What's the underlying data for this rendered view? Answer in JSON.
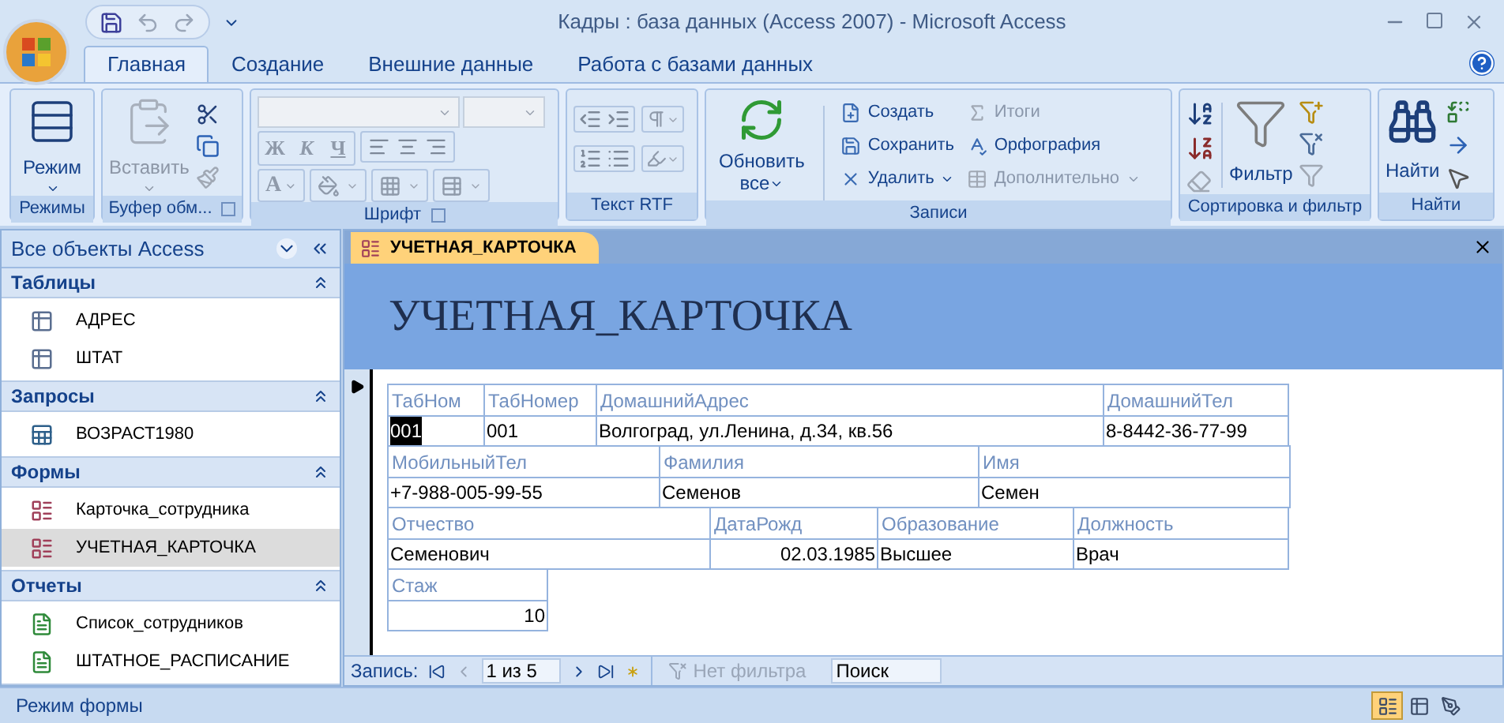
{
  "window": {
    "title": "Кадры : база данных (Access 2007) - Microsoft Access"
  },
  "ribbon_tabs": [
    {
      "label": "Главная",
      "selected": true
    },
    {
      "label": "Создание",
      "selected": false
    },
    {
      "label": "Внешние данные",
      "selected": false
    },
    {
      "label": "Работа с базами данных",
      "selected": false
    }
  ],
  "ribbon_groups": [
    {
      "kind": "views",
      "label": "Режимы",
      "launcher": false,
      "buttons": [
        {
          "label": "Режим",
          "disabled": false
        }
      ]
    },
    {
      "kind": "clipboard",
      "label": "Буфер обм...",
      "launcher": true,
      "buttons": [
        {
          "label": "Вставить",
          "disabled": true
        }
      ]
    },
    {
      "kind": "font",
      "label": "Шрифт",
      "launcher": true,
      "styles": [
        "Ж",
        "К",
        "Ч"
      ],
      "color_letter": "A",
      "disabled": true
    },
    {
      "kind": "rtf",
      "label": "Текст RTF",
      "launcher": false
    },
    {
      "kind": "records",
      "label": "Записи",
      "launcher": false,
      "large": {
        "label": "Обновить",
        "label_2": "все"
      },
      "buttons": [
        {
          "label": "Создать",
          "disabled": false,
          "dropdown": false
        },
        {
          "label": "Итоги",
          "disabled": true,
          "dropdown": false
        },
        {
          "label": "Сохранить",
          "disabled": false,
          "dropdown": false
        },
        {
          "label": "Орфография",
          "disabled": false,
          "dropdown": false
        },
        {
          "label": "Удалить",
          "disabled": false,
          "dropdown": true
        },
        {
          "label": "Дополнительно",
          "disabled": true,
          "dropdown": true
        }
      ]
    },
    {
      "kind": "sort",
      "label": "Сортировка и фильтр",
      "launcher": false,
      "buttons": [
        {
          "label": "Фильтр",
          "disabled": false
        }
      ]
    },
    {
      "kind": "find",
      "label": "Найти",
      "launcher": false,
      "buttons": [
        {
          "label": "Найти",
          "disabled": false
        }
      ]
    }
  ],
  "nav_pane": {
    "title": "Все объекты Access",
    "sections": [
      {
        "kind": "table",
        "title": "Таблицы",
        "items": [
          {
            "label": "АДРЕС",
            "selected": false
          },
          {
            "label": "ШТАТ",
            "selected": false
          }
        ]
      },
      {
        "kind": "query",
        "title": "Запросы",
        "items": [
          {
            "label": "ВОЗРАСТ1980",
            "selected": false
          }
        ]
      },
      {
        "kind": "form",
        "title": "Формы",
        "items": [
          {
            "label": "Карточка_сотрудника",
            "selected": false
          },
          {
            "label": "УЧЕТНАЯ_КАРТОЧКА",
            "selected": true
          }
        ]
      },
      {
        "kind": "report",
        "title": "Отчеты",
        "items": [
          {
            "label": "Список_сотрудников",
            "selected": false
          },
          {
            "label": "ШТАТНОЕ_РАСПИСАНИЕ",
            "selected": false
          }
        ]
      }
    ]
  },
  "document_tabs": [
    {
      "label": "УЧЕТНАЯ_КАРТОЧКА",
      "selected": true
    }
  ],
  "form": {
    "title": "УЧЕТНАЯ_КАРТОЧКА",
    "field_groups": [
      [
        {
          "label": "ТабНом",
          "value": "001",
          "kind": "text",
          "focused": true
        },
        {
          "label": "ТабНомер",
          "value": "001",
          "kind": "text",
          "focused": false
        },
        {
          "label": "ДомашнийАдрес",
          "value": "Волгоград, ул.Ленина, д.34, кв.56",
          "kind": "text",
          "focused": false
        },
        {
          "label": "ДомашнийТел",
          "value": "8-8442-36-77-99",
          "kind": "text",
          "focused": false
        }
      ],
      [
        {
          "label": "МобильныйТел",
          "value": "+7-988-005-99-55",
          "kind": "text",
          "focused": false
        },
        {
          "label": "Фамилия",
          "value": "Семенов",
          "kind": "text",
          "focused": false
        },
        {
          "label": "Имя",
          "value": "Семен",
          "kind": "text",
          "focused": false
        }
      ],
      [
        {
          "label": "Отчество",
          "value": "Семенович",
          "kind": "text",
          "focused": false
        },
        {
          "label": "ДатаРожд",
          "value": "02.03.1985",
          "kind": "number",
          "focused": false
        },
        {
          "label": "Образование",
          "value": "Высшее",
          "kind": "text",
          "focused": false
        },
        {
          "label": "Должность",
          "value": "Врач",
          "kind": "text",
          "focused": false
        }
      ],
      [
        {
          "label": "Стаж",
          "value": "10",
          "kind": "number",
          "focused": false
        }
      ]
    ]
  },
  "record_nav": {
    "label": "Запись:",
    "position": "1 из 5",
    "filter": {
      "label": "Нет фильтра",
      "disabled": true
    },
    "search": {
      "placeholder": "Поиск"
    }
  },
  "status_bar": {
    "text": "Режим формы",
    "views": [
      {
        "selected": true
      },
      {
        "selected": false
      },
      {
        "selected": false
      }
    ]
  }
}
